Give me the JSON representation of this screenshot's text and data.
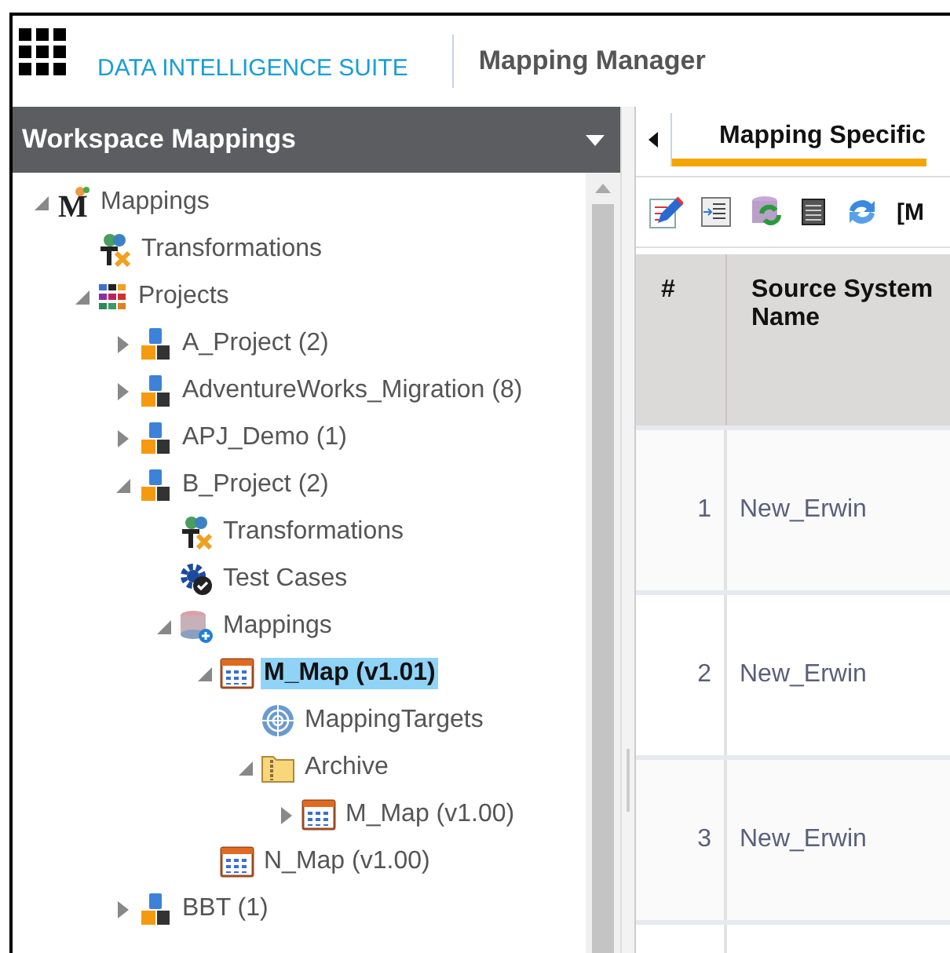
{
  "header": {
    "brand": "DATA INTELLIGENCE SUITE",
    "module": "Mapping Manager"
  },
  "sidebar": {
    "title": "Workspace Mappings",
    "tree": [
      {
        "label": "Mappings",
        "kind": "m-logo",
        "logo_letter": "M",
        "expanded": true,
        "selected": false,
        "children": [
          {
            "label": "Transformations",
            "kind": "tx",
            "selected": false
          },
          {
            "label": "Projects",
            "kind": "grid",
            "expanded": true,
            "selected": false,
            "children": [
              {
                "label": "A_Project (2)",
                "kind": "project",
                "expanded": false,
                "selected": false
              },
              {
                "label": "AdventureWorks_Migration (8)",
                "kind": "project",
                "expanded": false,
                "selected": false
              },
              {
                "label": "APJ_Demo (1)",
                "kind": "project",
                "expanded": false,
                "selected": false
              },
              {
                "label": "B_Project (2)",
                "kind": "project",
                "expanded": true,
                "selected": false,
                "children": [
                  {
                    "label": "Transformations",
                    "kind": "tx",
                    "selected": false
                  },
                  {
                    "label": "Test Cases",
                    "kind": "gear",
                    "selected": false
                  },
                  {
                    "label": "Mappings",
                    "kind": "db",
                    "expanded": true,
                    "selected": false,
                    "children": [
                      {
                        "label": "M_Map (v1.01)",
                        "kind": "map",
                        "expanded": true,
                        "selected": true,
                        "children": [
                          {
                            "label": "MappingTargets",
                            "kind": "target",
                            "selected": false
                          },
                          {
                            "label": "Archive",
                            "kind": "folder",
                            "expanded": true,
                            "selected": false,
                            "children": [
                              {
                                "label": "M_Map (v1.00)",
                                "kind": "map",
                                "expanded": false,
                                "selected": false
                              }
                            ]
                          }
                        ]
                      },
                      {
                        "label": "N_Map (v1.00)",
                        "kind": "map",
                        "selected": false
                      }
                    ]
                  }
                ]
              },
              {
                "label": "BBT (1)",
                "kind": "project",
                "expanded": false,
                "selected": false
              }
            ]
          }
        ]
      }
    ]
  },
  "tabs": [
    {
      "label": "Mapping Specific",
      "selected": true
    }
  ],
  "toolbar": {
    "trailing_text": "[M"
  },
  "table": {
    "columns": [
      "#",
      "Source System Name"
    ],
    "rows": [
      [
        "1",
        "New_Erwin"
      ],
      [
        "2",
        "New_Erwin"
      ],
      [
        "3",
        "New_Erwin"
      ]
    ]
  }
}
